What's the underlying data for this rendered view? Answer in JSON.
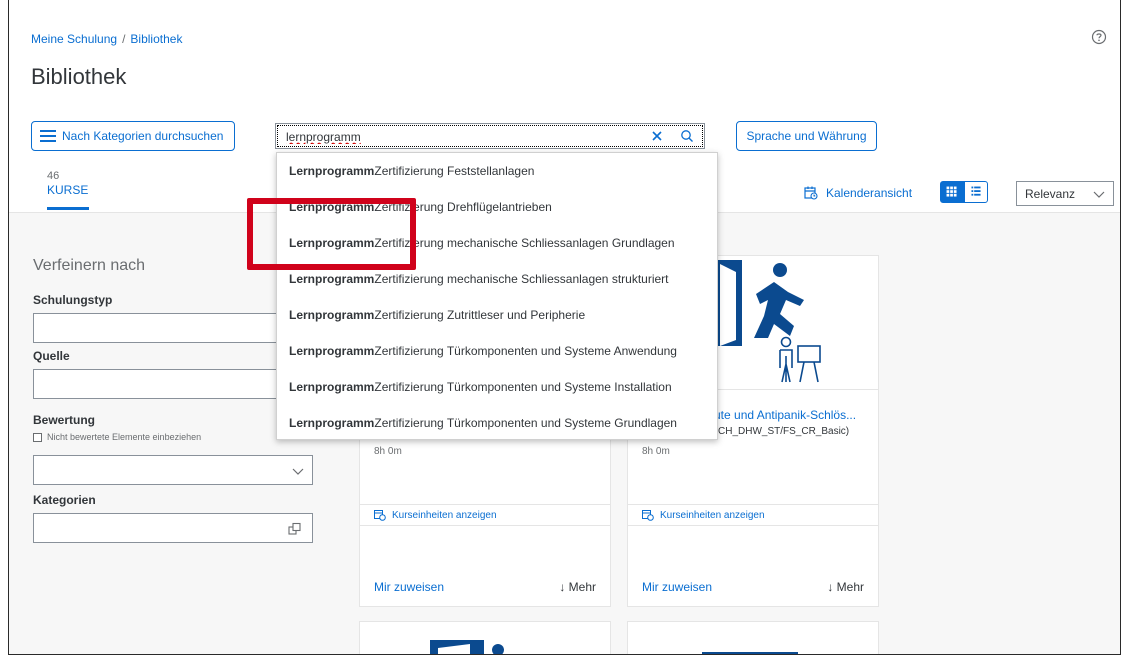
{
  "header": {
    "breadcrumb": {
      "root": "Meine Schulung",
      "separator": "/",
      "current": "Bibliothek"
    },
    "title": "Bibliothek",
    "browse_button": "Nach Kategorien durchsuchen",
    "language_button": "Sprache und Währung",
    "help_icon": "help-circle-icon"
  },
  "search": {
    "value": "lernprogramm",
    "placeholder": ""
  },
  "suggestions": [
    {
      "bold": "Lernprogramm",
      "rest": " Zertifizierung Feststellanlagen"
    },
    {
      "bold": "Lernprogramm",
      "rest": " Zertifizierung Drehflügelantrieben"
    },
    {
      "bold": "Lernprogramm",
      "rest": " Zertifizierung mechanische Schliessanlagen Grundlagen"
    },
    {
      "bold": "Lernprogramm",
      "rest": " Zertifizierung mechanische Schliessanlagen strukturiert"
    },
    {
      "bold": "Lernprogramm",
      "rest": " Zertifizierung Zutrittleser und Peripherie"
    },
    {
      "bold": "Lernprogramm",
      "rest": " Zertifizierung Türkomponenten und Systeme Anwendung"
    },
    {
      "bold": "Lernprogramm",
      "rest": " Zertifizierung Türkomponenten und Systeme Installation"
    },
    {
      "bold": "Lernprogramm",
      "rest": " Zertifizierung Türkomponenten und Systeme Grundlagen"
    }
  ],
  "tabs": {
    "courses_count": "46",
    "courses_label": "KURSE"
  },
  "toolbar": {
    "calendar_view": "Kalenderansicht",
    "sort_value": "Relevanz"
  },
  "filters": {
    "title": "Verfeinern nach",
    "training_type": "Schulungstyp",
    "source": "Quelle",
    "rating": "Bewertung",
    "include_unrated": "Nicht bewertete Elemente einbeziehen",
    "categories": "Kategorien"
  },
  "cards": [
    {
      "duration": "8h 0m",
      "units_link": "Kurseinheiten anzeigen",
      "assign": "Mir zuweisen",
      "more": "↓ Mehr"
    },
    {
      "title": "ute und Antipanik-Schlös...",
      "id": "CH_DHW_ST/FS_CR_Basic)",
      "duration": "8h 0m",
      "units_link": "Kurseinheiten anzeigen",
      "assign": "Mir zuweisen",
      "more": "↓ Mehr"
    }
  ],
  "colors": {
    "brand": "#0a6ed1",
    "highlight": "#d0021b",
    "icon_dark": "#0b4a8f"
  }
}
